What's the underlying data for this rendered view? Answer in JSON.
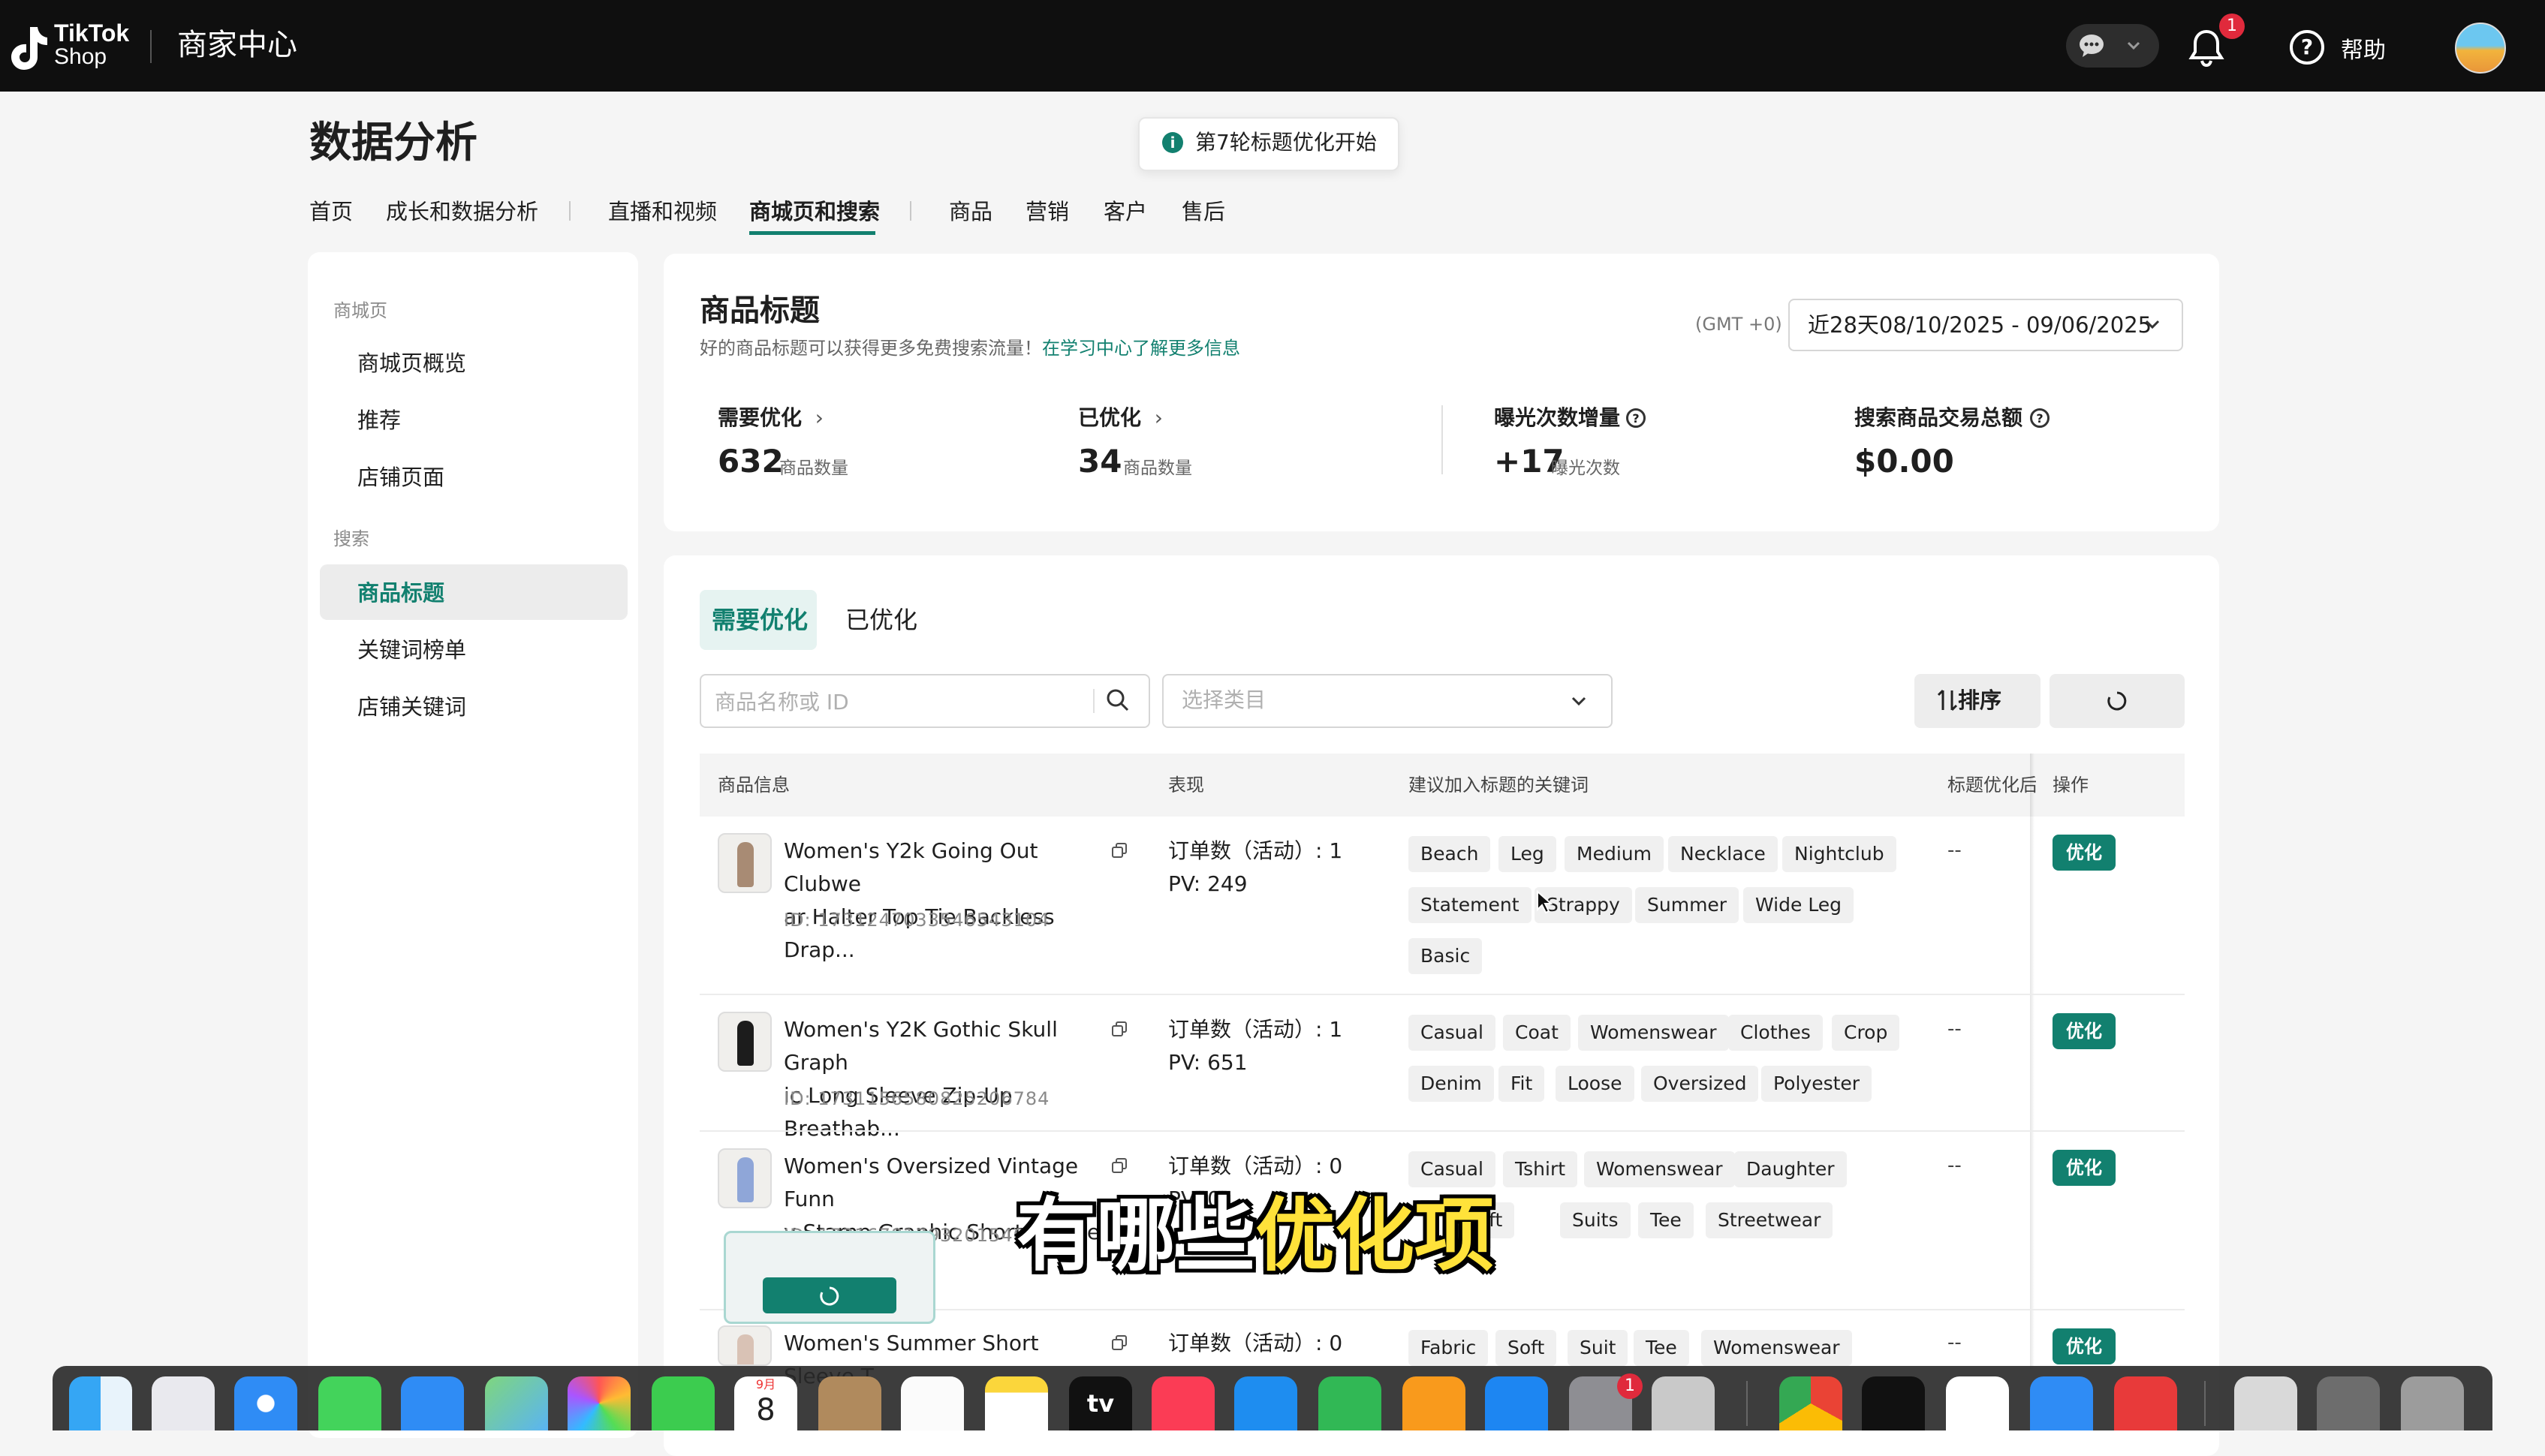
{
  "header": {
    "brand_line1": "TikTok",
    "brand_line2": "Shop",
    "app_title": "商家中心",
    "notification_count": "1",
    "help_label": "帮助"
  },
  "page": {
    "title": "数据分析",
    "toast": "第7轮标题优化开始"
  },
  "nav": {
    "items": [
      "首页",
      "成长和数据分析",
      "直播和视频",
      "商城页和搜索",
      "商品",
      "营销",
      "客户",
      "售后"
    ],
    "active": "商城页和搜索"
  },
  "sidebar": {
    "group1": "商城页",
    "group1_items": [
      "商城页概览",
      "推荐",
      "店铺页面"
    ],
    "group2": "搜索",
    "group2_items": [
      "商品标题",
      "关键词榜单",
      "店铺关键词"
    ],
    "active": "商品标题"
  },
  "summary": {
    "title": "商品标题",
    "subtitle": "好的商品标题可以获得更多免费搜索流量！",
    "link": "在学习中心了解更多信息",
    "timezone": "(GMT +0)",
    "date_range": "近28天08/10/2025 - 09/06/2025",
    "metrics": [
      {
        "label": "需要优化",
        "value": "632",
        "unit": "商品数量"
      },
      {
        "label": "已优化",
        "value": "34",
        "unit": "商品数量"
      },
      {
        "label": "曝光次数增量",
        "value": "+17",
        "unit": "曝光次数"
      },
      {
        "label": "搜索商品交易总额",
        "value": "$0.00",
        "unit": ""
      }
    ]
  },
  "table": {
    "tabs": [
      "需要优化",
      "已优化"
    ],
    "search_placeholder": "商品名称或 ID",
    "category_placeholder": "选择类目",
    "sort_label": "排序",
    "headers": [
      "商品信息",
      "表现",
      "建议加入标题的关键词",
      "标题优化后",
      "操作"
    ],
    "action_label": "优化",
    "rows": [
      {
        "name_line1": "Women's Y2k Going Out Clubwe",
        "name_line2": "ar Halter Top Tie Backless Drap...",
        "id": "ID: 1731247033546543104",
        "orders": "订单数（活动）: 1",
        "pv": "PV: 249",
        "keywords": [
          "Beach",
          "Leg",
          "Medium",
          "Necklace",
          "Nightclub",
          "Statement",
          "Strappy",
          "Summer",
          "Wide Leg",
          "Basic"
        ],
        "after": "--"
      },
      {
        "name_line1": "Women's Y2K Gothic Skull Graph",
        "name_line2": "ic Long Sleeve Zip-Up Breathab...",
        "id": "ID: 1731156580825206784",
        "orders": "订单数（活动）: 1",
        "pv": "PV: 651",
        "keywords": [
          "Casual",
          "Coat",
          "Womenswear",
          "Clothes",
          "Crop",
          "Denim",
          "Fit",
          "Loose",
          "Oversized",
          "Polyester"
        ],
        "after": "--"
      },
      {
        "name_line1": "Women's Oversized Vintage Funn",
        "name_line2": "y Stamp Graphic Short Sleeve C...",
        "id": "ID: 17316781793201540",
        "orders": "订单数（活动）: 0",
        "pv": "PV: 0",
        "keywords": [
          "Casual",
          "Tshirt",
          "Womenswear",
          "Daughter",
          "Soft",
          "Suits",
          "Tee",
          "Streetwear"
        ],
        "after": "--"
      },
      {
        "name_line1": "Women's Summer Short Sleeve T",
        "orders": "订单数（活动）: 0",
        "keywords": [
          "Fabric",
          "Soft",
          "Suit",
          "Tee",
          "Womenswear"
        ],
        "after": "--"
      }
    ]
  },
  "overlay": {
    "subtitle_white": "有哪些",
    "subtitle_yellow": "优化项"
  },
  "dock": {
    "calendar_month": "9月",
    "calendar_day": "8",
    "settings_badge": "1",
    "tv_label": "tv"
  }
}
